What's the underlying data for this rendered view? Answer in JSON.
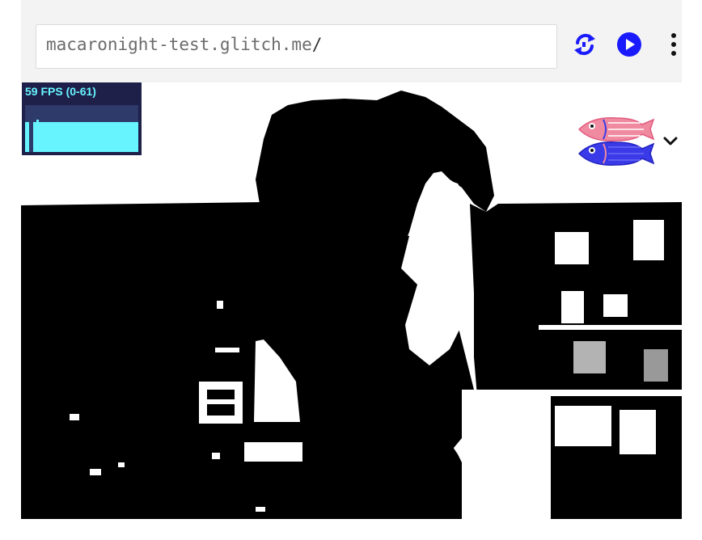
{
  "address_bar": {
    "url": "macaronight-test.glitch.me",
    "url_suffix": "/"
  },
  "toolbar": {
    "icons": [
      "refresh-icon",
      "play-icon",
      "more-vertical-icon"
    ],
    "accent_color": "#1a1aff"
  },
  "fps_monitor": {
    "label": "59 FPS (0-61)",
    "fps": 59,
    "min": 0,
    "max": 61,
    "text_color": "#68f4ff",
    "background_color": "#1e2049"
  },
  "preview": {
    "description_icon": "threshold-webcam-image",
    "colors": [
      "#000000",
      "#ffffff"
    ]
  },
  "fish_menu": {
    "icons": [
      "pink-fish-icon",
      "blue-fish-icon",
      "chevron-down-icon"
    ],
    "colors": {
      "pink": "#f08aa0",
      "blue": "#3a3ae8"
    }
  }
}
